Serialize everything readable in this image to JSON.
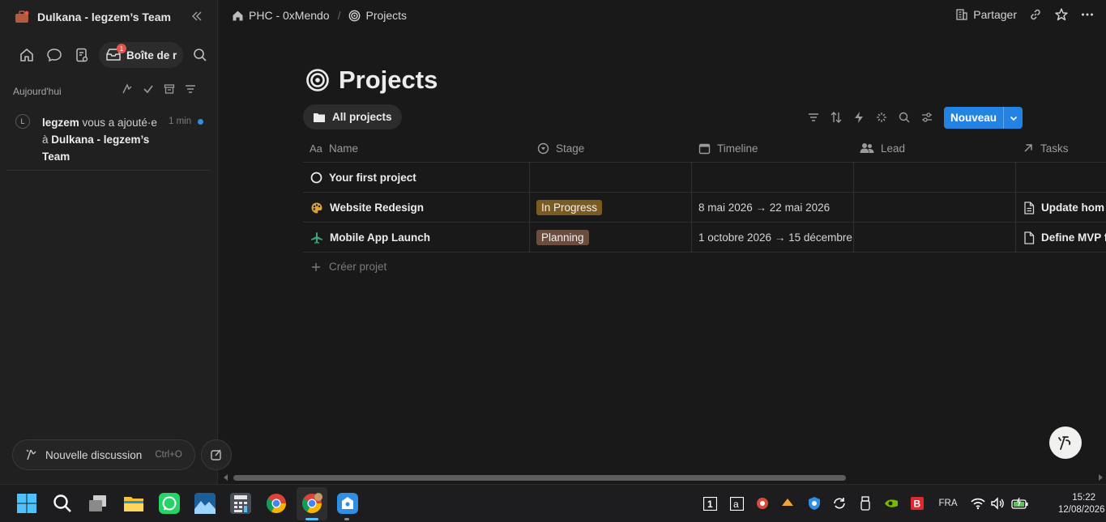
{
  "sidebar": {
    "workspace_name": "Dulkana - legzem’s Team",
    "inbox_label": "Boîte de r",
    "inbox_badge": "1",
    "section_label": "Aujourd'hui",
    "notification": {
      "avatar_letter": "L",
      "actor": "legzem",
      "action": " vous a ajouté·e à ",
      "target": "Dulkana - legzem’s Team",
      "time": "1 min"
    },
    "new_chat_label": "Nouvelle discussion",
    "new_chat_shortcut": "Ctrl+O"
  },
  "topbar": {
    "breadcrumb": [
      "PHC - 0xMendo",
      "Projects"
    ],
    "share_label": "Partager"
  },
  "page": {
    "title": "Projects",
    "view_tab": "All projects",
    "new_button": "Nouveau",
    "columns": [
      "Name",
      "Stage",
      "Timeline",
      "Lead",
      "Tasks"
    ],
    "rows": [
      {
        "name": "Your first project",
        "icon": "circle-icon",
        "stage": "",
        "timeline": "",
        "lead": "",
        "task": ""
      },
      {
        "name": "Website Redesign",
        "icon": "palette-icon",
        "stage": "In Progress",
        "stage_color": "#7a5c22",
        "timeline": "8 mai 2026 → 22 mai 2026",
        "lead": "",
        "task": "Update hom"
      },
      {
        "name": "Mobile App Launch",
        "icon": "airplane-icon",
        "stage": "Planning",
        "stage_color": "#6b4d3f",
        "timeline": "1 octobre 2026 → 15 décembre",
        "lead": "",
        "task": "Define MVP f"
      }
    ],
    "create_label": "Créer projet"
  },
  "taskbar": {
    "language": "FRA",
    "time": "15:22",
    "date": "12/08/2026"
  }
}
